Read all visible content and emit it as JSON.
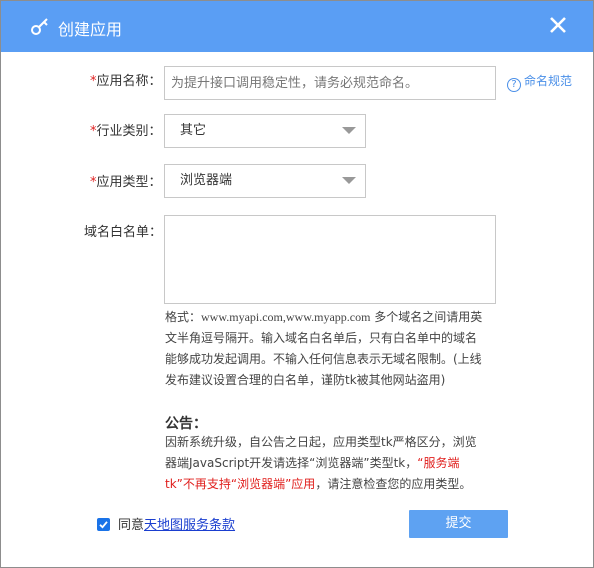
{
  "dialog": {
    "title": "创建应用",
    "title_icon": "key-icon",
    "close_icon": "close-icon"
  },
  "form": {
    "app_name": {
      "required_mark": "*",
      "label": "应用名称：",
      "placeholder": "为提升接口调用稳定性，请务必规范命名。",
      "value": ""
    },
    "naming_help": {
      "icon": "question-circle-icon",
      "label": "命名规范"
    },
    "industry": {
      "required_mark": "*",
      "label": "行业类别：",
      "selected": "其它"
    },
    "app_type": {
      "required_mark": "*",
      "label": "应用类型：",
      "selected": "浏览器端"
    },
    "whitelist": {
      "label": "域名白名单：",
      "value": "",
      "hint_prefix": "格式：",
      "hint_example": "www.myapi.com,www.myapp.com",
      "hint_rest": " 多个域名之间请用英文半角逗号隔开。输入域名白名单后，只有白名单中的域名能够成功发起调用。不输入任何信息表示无域名限制。(上线发布建议设置合理的白名单，谨防tk被其他网站盗用)"
    }
  },
  "notice": {
    "title": "公告：",
    "text_before": "因新系统升级，自公告之日起，应用类型tk严格区分，浏览器端JavaScript开发请选择“浏览器端”类型tk，",
    "text_red": "“服务端tk”不再支持“浏览器端”应用",
    "text_after": "，请注意检查您的应用类型。"
  },
  "footer": {
    "agree_checked": true,
    "agree_prefix": "同意",
    "agree_link": "天地图服务条款",
    "submit_label": "提交"
  },
  "colors": {
    "titlebar": "#5a9ef4",
    "submit": "#5ea2f2",
    "required": "#e02020",
    "link": "#4a8fe8"
  }
}
